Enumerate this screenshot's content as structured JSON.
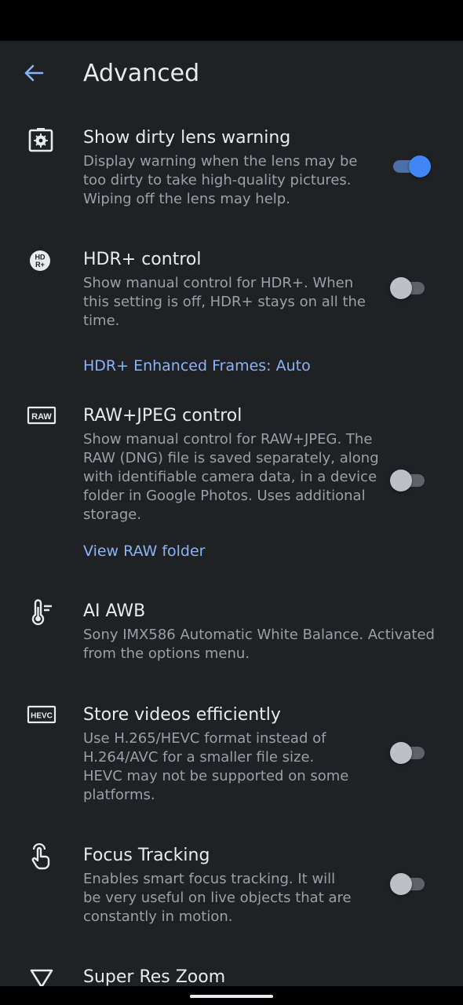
{
  "appbar": {
    "title": "Advanced"
  },
  "settings": [
    {
      "title": "Show dirty lens warning",
      "desc": [
        "Display warning when the lens may be",
        "too dirty to take high-quality pictures.",
        "Wiping off the lens may help."
      ],
      "icon": "dirty-lens-icon",
      "toggle": true
    },
    {
      "title": "HDR+ control",
      "desc": [
        "Show manual control for HDR+. When",
        "this setting is off, HDR+ stays on all the",
        "time."
      ],
      "icon": "hdr-plus-icon",
      "toggle": false
    },
    {
      "title": "RAW+JPEG control",
      "desc": [
        "Show manual control for RAW+JPEG. The",
        "RAW (DNG) file is saved separately, along",
        "with identifiable camera data, in a device",
        "folder in Google Photos. Uses additional",
        "storage."
      ],
      "icon": "raw-icon",
      "toggle": false
    },
    {
      "title": "AI AWB",
      "desc": [
        "Sony IMX586 Automatic White Balance. Activated",
        "from the options menu."
      ],
      "icon": "thermometer-icon"
    },
    {
      "title": "Store videos efficiently",
      "desc": [
        "Use H.265/HEVC format instead of",
        "H.264/AVC for a smaller file size.",
        "HEVC may not be supported on some",
        "platforms."
      ],
      "icon": "hevc-icon",
      "toggle": false
    },
    {
      "title": "Focus Tracking",
      "desc": [
        "Enables smart focus tracking. It will",
        "be very useful on live objects that are",
        "constantly in motion."
      ],
      "icon": "touch-hand-icon",
      "toggle": false
    },
    {
      "title": "Super Res Zoom",
      "icon": "triangle-icon"
    }
  ],
  "links": {
    "hdr_enhanced": "HDR+ Enhanced Frames: Auto",
    "view_raw": "View RAW folder"
  },
  "colors": {
    "background": "#202124",
    "accent": "#4285f4",
    "link": "#8ab4f8",
    "secondary_text": "#9aa0a6"
  }
}
